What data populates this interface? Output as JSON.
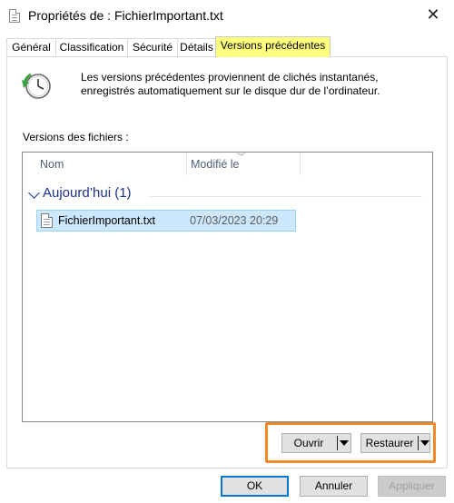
{
  "window": {
    "title": "Propriétés de : FichierImportant.txt",
    "close_glyph": "✕"
  },
  "tabs": [
    {
      "label": "Général",
      "active": false
    },
    {
      "label": "Classification",
      "active": false
    },
    {
      "label": "Sécurité",
      "active": false
    },
    {
      "label": "Détails",
      "active": false
    },
    {
      "label": "Versions précédentes",
      "active": true
    }
  ],
  "info": {
    "icon": "clock-restore-icon",
    "text": "Les versions précédentes proviennent de clichés instantanés, enregistrés automatiquement sur le disque dur de l’ordinateur."
  },
  "versions": {
    "label": "Versions des fichiers :",
    "columns": [
      "Nom",
      "Modifié le"
    ],
    "groups": [
      {
        "title": "Aujourd’hui (1)",
        "items": [
          {
            "name": "FichierImportant.txt",
            "modified": "07/03/2023 20:29",
            "selected": true
          }
        ]
      }
    ]
  },
  "actions": {
    "open_label": "Ouvrir",
    "restore_label": "Restaurer"
  },
  "footer": {
    "ok_label": "OK",
    "cancel_label": "Annuler",
    "apply_label": "Appliquer"
  },
  "colors": {
    "active_tab_highlight": "#ffff7f",
    "callout_border": "#f0892a",
    "selection": "#cce8ff",
    "group_header": "#1e3287",
    "default_button_border": "#0078d7"
  }
}
